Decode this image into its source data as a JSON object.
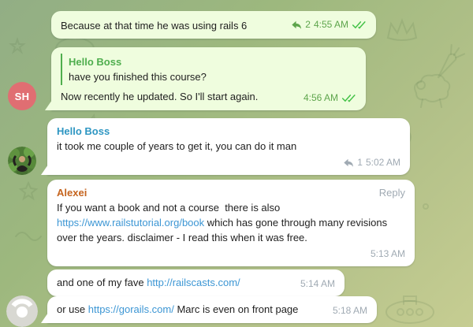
{
  "app": "telegram-chat-window",
  "colors": {
    "bubble_in": "#ffffff",
    "bubble_out": "#effdde",
    "background_top": "#92ae85",
    "background_bottom": "#c6cd92",
    "link": "#3c96d4",
    "check_green": "#43c247",
    "meta_out_green": "#5ea54c",
    "meta_in_gray": "#a0aab3",
    "name_blue": "#2e96c2",
    "name_orange": "#c5641e",
    "name_green": "#4fae4e",
    "avatar_red": "#e06e72"
  },
  "avatars": {
    "sh": {
      "initials": "SH"
    }
  },
  "messages": {
    "m1": {
      "text": "Because at that time he was using rails 6",
      "reply_count": "2",
      "time": "4:55 AM"
    },
    "m2": {
      "quote_name": "Hello Boss",
      "quote_text": "have you finished this course?",
      "text": "Now recently he updated. So I'll start again.",
      "time": "4:56 AM"
    },
    "m3": {
      "name": "Hello Boss",
      "text": "it took me couple of years to get it, you can do it man",
      "reply_count": "1",
      "time": "5:02 AM"
    },
    "m4": {
      "name": "Alexei",
      "reply_label": "Reply",
      "text_before": "If you want a book and not a course  there is also ",
      "link": "https://www.railstutorial.org/book",
      "text_after": " which has gone through many revisions over the years. disclaimer - I read this when it was free.",
      "time": "5:13 AM"
    },
    "m5": {
      "text_before": "and one of my fave ",
      "link": "http://railscasts.com/",
      "time": "5:14 AM"
    },
    "m6": {
      "text_before": "or use ",
      "link": "https://gorails.com/",
      "text_after": " Marc is even on front page",
      "time": "5:18 AM"
    }
  }
}
